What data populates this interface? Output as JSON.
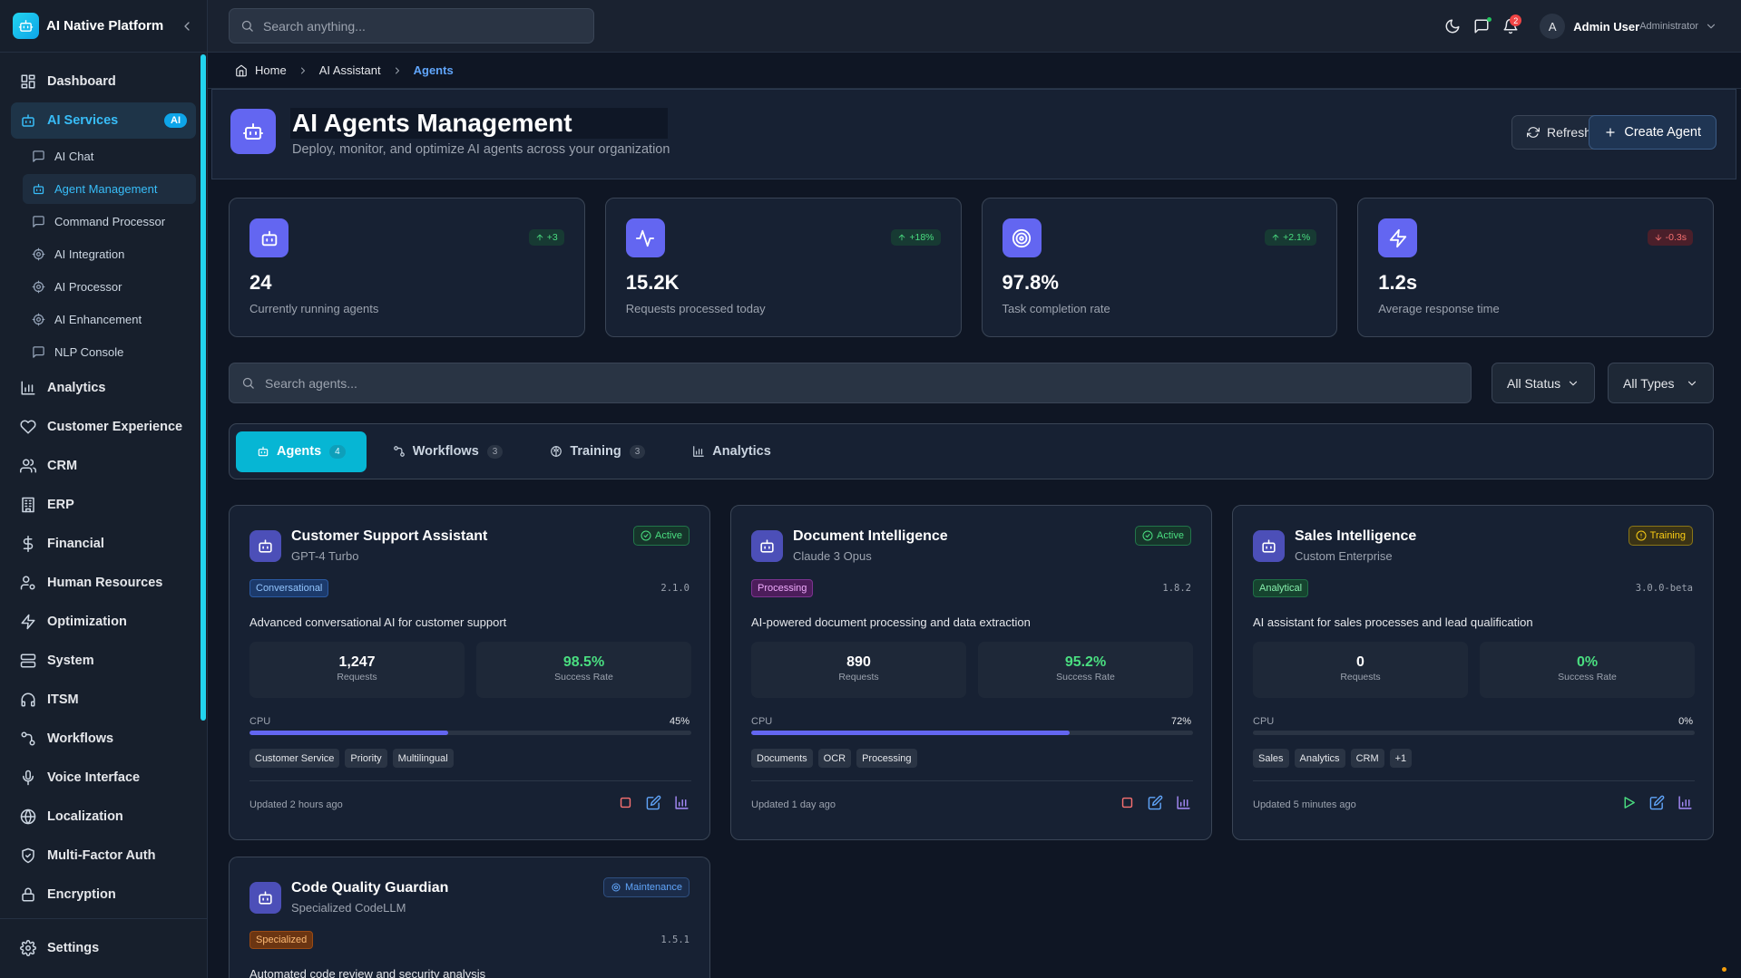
{
  "app": {
    "name": "AI Native Platform"
  },
  "sidebar": {
    "items": [
      {
        "label": "Dashboard",
        "icon": "dashboard-icon"
      },
      {
        "label": "AI Services",
        "icon": "bot-icon",
        "badge": "AI"
      },
      {
        "label": "Analytics",
        "icon": "chart-icon"
      },
      {
        "label": "Customer Experience",
        "icon": "heart-icon"
      },
      {
        "label": "CRM",
        "icon": "users-icon"
      },
      {
        "label": "ERP",
        "icon": "building-icon"
      },
      {
        "label": "Financial",
        "icon": "dollar-icon"
      },
      {
        "label": "Human Resources",
        "icon": "user-cog-icon"
      },
      {
        "label": "Optimization",
        "icon": "zap-icon"
      },
      {
        "label": "System",
        "icon": "server-icon"
      },
      {
        "label": "ITSM",
        "icon": "headphones-icon"
      },
      {
        "label": "Workflows",
        "icon": "workflow-icon"
      },
      {
        "label": "Voice Interface",
        "icon": "mic-icon"
      },
      {
        "label": "Localization",
        "icon": "globe-icon"
      },
      {
        "label": "Multi-Factor Auth",
        "icon": "shield-icon"
      },
      {
        "label": "Encryption",
        "icon": "lock-icon"
      }
    ],
    "subitems": [
      {
        "label": "AI Chat"
      },
      {
        "label": "Agent Management"
      },
      {
        "label": "Command Processor"
      },
      {
        "label": "AI Integration"
      },
      {
        "label": "AI Processor"
      },
      {
        "label": "AI Enhancement"
      },
      {
        "label": "NLP Console"
      }
    ],
    "settings_label": "Settings"
  },
  "topbar": {
    "search_placeholder": "Search anything...",
    "notification_count": "2",
    "avatar_initial": "A",
    "user_name": "Admin User",
    "user_role": "Administrator"
  },
  "breadcrumb": [
    "Home",
    "AI Assistant",
    "Agents"
  ],
  "header": {
    "title": "AI Agents Management",
    "subtitle": "Deploy, monitor, and optimize AI agents across your organization",
    "refresh_label": "Refresh",
    "create_label": "Create Agent"
  },
  "stats": [
    {
      "value": "24",
      "label": "Currently running agents",
      "trend": "+3",
      "dir": "up"
    },
    {
      "value": "15.2K",
      "label": "Requests processed today",
      "trend": "+18%",
      "dir": "up"
    },
    {
      "value": "97.8%",
      "label": "Task completion rate",
      "trend": "+2.1%",
      "dir": "up"
    },
    {
      "value": "1.2s",
      "label": "Average response time",
      "trend": "-0.3s",
      "dir": "down"
    }
  ],
  "filters": {
    "search_placeholder": "Search agents...",
    "status": "All Status",
    "type": "All Types"
  },
  "tabs": [
    {
      "label": "Agents",
      "count": "4"
    },
    {
      "label": "Workflows",
      "count": "3"
    },
    {
      "label": "Training",
      "count": "3"
    },
    {
      "label": "Analytics",
      "count": ""
    }
  ],
  "agents": [
    {
      "name": "Customer Support Assistant",
      "model": "GPT-4 Turbo",
      "status": "Active",
      "type": "Conversational",
      "version": "2.1.0",
      "description": "Advanced conversational AI for customer support",
      "requests": "1,247",
      "requests_label": "Requests",
      "success": "98.5%",
      "success_label": "Success Rate",
      "cpu_label": "CPU",
      "cpu": "45%",
      "cpu_value": 45,
      "tags": [
        "Customer Service",
        "Priority",
        "Multilingual"
      ],
      "updated": "Updated 2 hours ago"
    },
    {
      "name": "Document Intelligence",
      "model": "Claude 3 Opus",
      "status": "Active",
      "type": "Processing",
      "version": "1.8.2",
      "description": "AI-powered document processing and data extraction",
      "requests": "890",
      "requests_label": "Requests",
      "success": "95.2%",
      "success_label": "Success Rate",
      "cpu_label": "CPU",
      "cpu": "72%",
      "cpu_value": 72,
      "tags": [
        "Documents",
        "OCR",
        "Processing"
      ],
      "updated": "Updated 1 day ago"
    },
    {
      "name": "Sales Intelligence",
      "model": "Custom Enterprise",
      "status": "Training",
      "type": "Analytical",
      "version": "3.0.0-beta",
      "description": "AI assistant for sales processes and lead qualification",
      "requests": "0",
      "requests_label": "Requests",
      "success": "0%",
      "success_label": "Success Rate",
      "cpu_label": "CPU",
      "cpu": "0%",
      "cpu_value": 0,
      "tags": [
        "Sales",
        "Analytics",
        "CRM",
        "+1"
      ],
      "updated": "Updated 5 minutes ago"
    },
    {
      "name": "Code Quality Guardian",
      "model": "Specialized CodeLLM",
      "status": "Maintenance",
      "type": "Specialized",
      "version": "1.5.1",
      "description": "Automated code review and security analysis"
    }
  ]
}
